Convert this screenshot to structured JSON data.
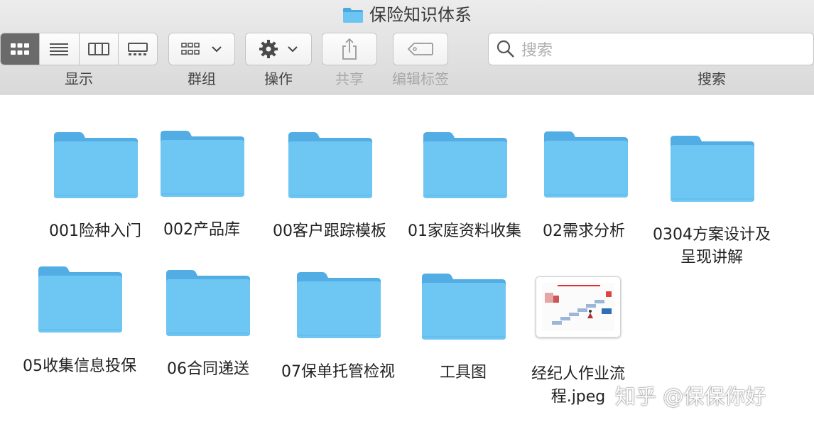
{
  "window": {
    "title": "保险知识体系",
    "folder_icon": "folder-icon"
  },
  "toolbar": {
    "view_label": "显示",
    "group_label": "群组",
    "action_label": "操作",
    "share_label": "共享",
    "tags_label": "编辑标签",
    "search_label": "搜索",
    "search_placeholder": "搜索"
  },
  "items": [
    {
      "name": "001险种入门",
      "type": "folder"
    },
    {
      "name": "002产品库",
      "type": "folder"
    },
    {
      "name": "00客户跟踪模板",
      "type": "folder"
    },
    {
      "name": "01家庭资料收集",
      "type": "folder"
    },
    {
      "name": "02需求分析",
      "type": "folder"
    },
    {
      "name_line1": "0304方案设计及",
      "name_line2": "呈现讲解",
      "type": "folder"
    },
    {
      "name": "05收集信息投保",
      "type": "folder"
    },
    {
      "name": "06合同递送",
      "type": "folder"
    },
    {
      "name": "07保单托管检视",
      "type": "folder"
    },
    {
      "name": "工具图",
      "type": "folder"
    },
    {
      "name_line1": "经纪人作业流",
      "name_line2": "程.jpeg",
      "type": "image"
    }
  ],
  "watermark": "知乎 @保保你好",
  "colors": {
    "folder_front": "#6cc4f2",
    "folder_back": "#5cb5e8",
    "toolbar": "#e3e3e3"
  }
}
